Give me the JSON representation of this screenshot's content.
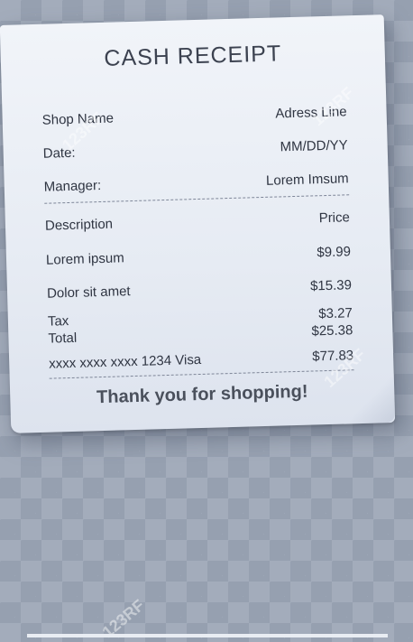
{
  "receipt": {
    "title": "CASH  RECEIPT",
    "shop_name_label": "Shop Name",
    "address_value": "Adress Line",
    "date_label": "Date:",
    "date_value": "MM/DD/YY",
    "manager_label": "Manager:",
    "manager_value": "Lorem Imsum",
    "items_header": {
      "description": "Description",
      "price": "Price"
    },
    "items": [
      {
        "description": "Lorem ipsum",
        "price": "$9.99"
      },
      {
        "description": "Dolor sit amet",
        "price": "$15.39"
      }
    ],
    "tax_label": "Tax",
    "tax_value": "$3.27",
    "total_label": "Total",
    "total_value": "$25.38",
    "card_label": "xxxx xxxx xxxx 1234 Visa",
    "card_value": "$77.83",
    "thank_you": "Thank you for shopping!"
  },
  "watermark": "123RF"
}
